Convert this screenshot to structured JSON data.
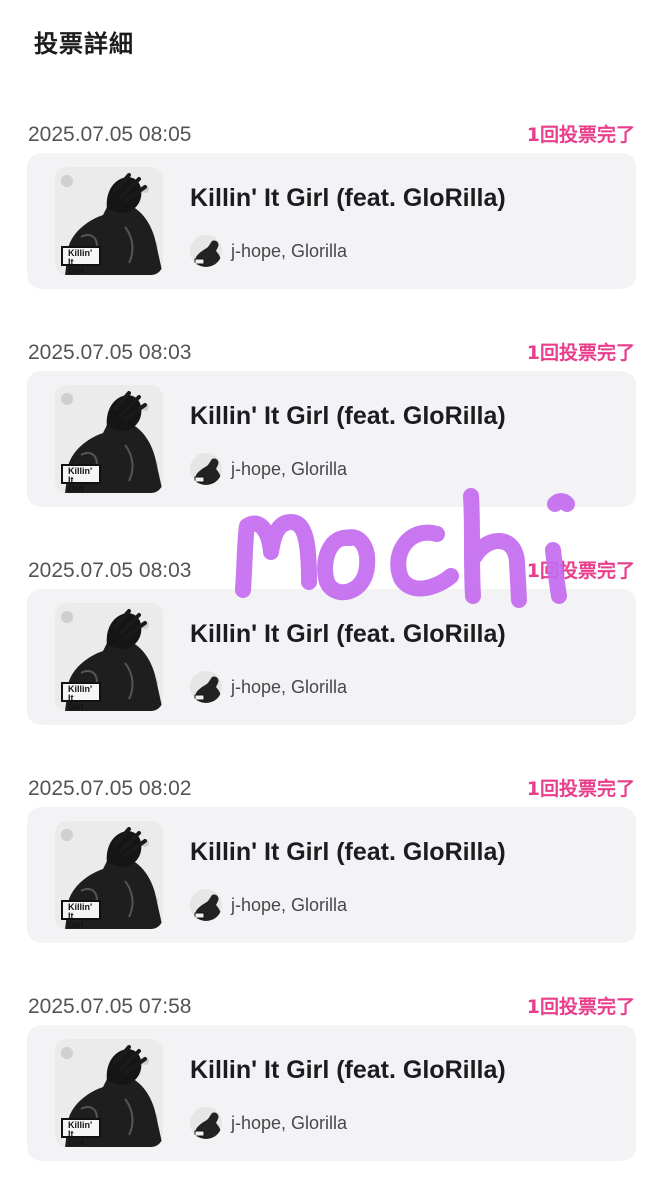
{
  "header": {
    "title": "投票詳細"
  },
  "colors": {
    "status": "#e83e8c",
    "card_bg": "#f3f3f5",
    "scribble": "#c46cf0"
  },
  "votes": [
    {
      "time": "2025.07.05 08:05",
      "status": "1回投票完了",
      "title": "Killin' It Girl (feat. GloRilla)",
      "artists": "j-hope, Glorilla",
      "cover_text": "Killin' It\nGirl"
    },
    {
      "time": "2025.07.05 08:03",
      "status": "1回投票完了",
      "title": "Killin' It Girl (feat. GloRilla)",
      "artists": "j-hope, Glorilla",
      "cover_text": "Killin' It\nGirl"
    },
    {
      "time": "2025.07.05 08:03",
      "status": "1回投票完了",
      "title": "Killin' It Girl (feat. GloRilla)",
      "artists": "j-hope, Glorilla",
      "cover_text": "Killin' It\nGirl"
    },
    {
      "time": "2025.07.05 08:02",
      "status": "1回投票完了",
      "title": "Killin' It Girl (feat. GloRilla)",
      "artists": "j-hope, Glorilla",
      "cover_text": "Killin' It\nGirl"
    },
    {
      "time": "2025.07.05 07:58",
      "status": "1回投票完了",
      "title": "Killin' It Girl (feat. GloRilla)",
      "artists": "j-hope, Glorilla",
      "cover_text": "Killin' It\nGirl"
    }
  ],
  "overlay": {
    "scribble_text": "mochi"
  },
  "icons": {
    "cover": "album-cover-icon",
    "avatar": "artist-avatar-icon"
  }
}
